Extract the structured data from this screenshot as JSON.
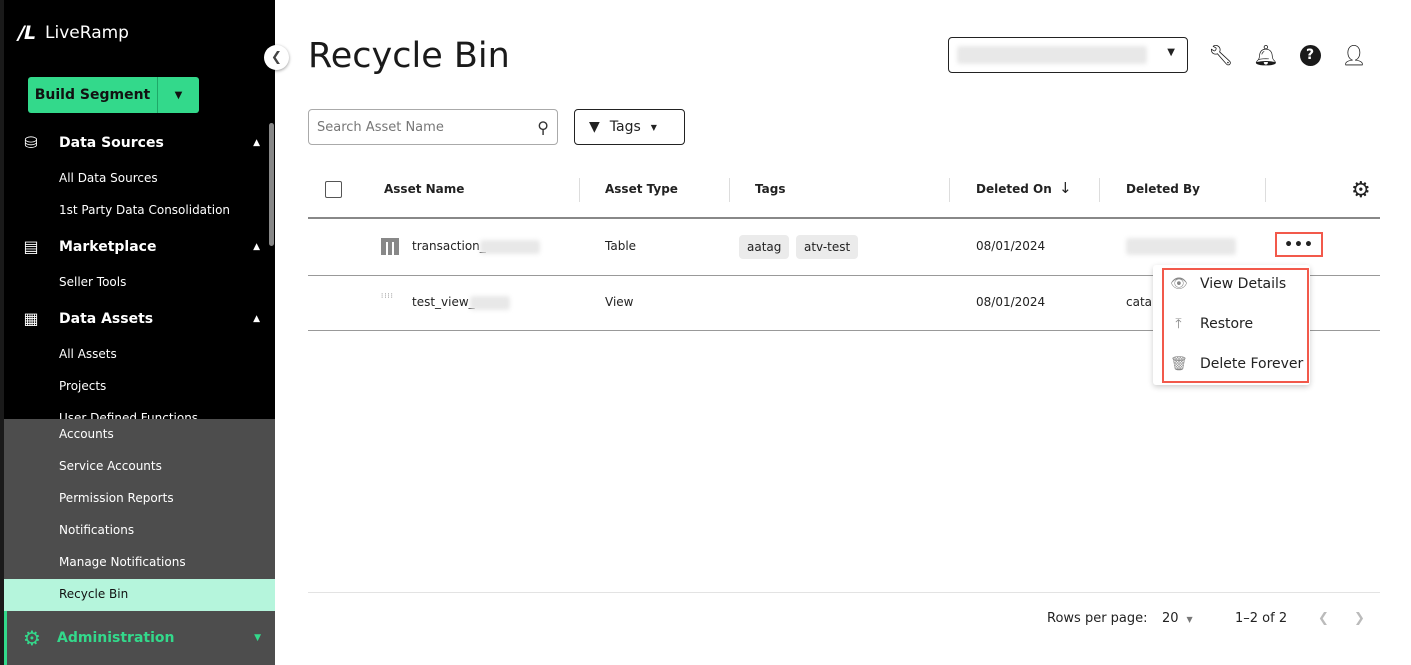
{
  "brand": {
    "name": "LiveRamp",
    "mark": "/L"
  },
  "sidebar": {
    "build_label": "Build Segment",
    "sections": [
      {
        "label": "Data Sources",
        "icon": "data-sources-icon",
        "items": [
          "All Data Sources",
          "1st Party Data Consolidation"
        ]
      },
      {
        "label": "Marketplace",
        "icon": "marketplace-icon",
        "items": [
          "Seller Tools"
        ]
      },
      {
        "label": "Data Assets",
        "icon": "data-assets-icon",
        "items": [
          "All Assets",
          "Projects",
          "User Defined Functions"
        ]
      }
    ],
    "admin_items": [
      "Accounts",
      "Service Accounts",
      "Permission Reports",
      "Notifications",
      "Manage Notifications",
      "Recycle Bin"
    ],
    "admin_label": "Administration",
    "active": "Recycle Bin"
  },
  "header": {
    "title": "Recycle Bin",
    "icons": [
      "wrench-icon",
      "bell-icon",
      "help-icon",
      "user-icon"
    ]
  },
  "toolbar": {
    "search_placeholder": "Search Asset Name",
    "tags_label": "Tags"
  },
  "table": {
    "columns": [
      "Asset Name",
      "Asset Type",
      "Tags",
      "Deleted On",
      "Deleted By"
    ],
    "sort": {
      "column": "Deleted On",
      "direction": "desc"
    },
    "rows": [
      {
        "name": "transaction_",
        "type": "Table",
        "tags": [
          "aatag",
          "atv-test"
        ],
        "deleted_on": "08/01/2024",
        "deleted_by": ""
      },
      {
        "name": "test_view_",
        "type": "View",
        "tags": [],
        "deleted_on": "08/01/2024",
        "deleted_by": "catal"
      }
    ]
  },
  "menu": {
    "items": [
      "View Details",
      "Restore",
      "Delete Forever"
    ]
  },
  "footer": {
    "rows_label": "Rows per page:",
    "rows_value": "20",
    "range": "1–2 of 2"
  },
  "colors": {
    "accent": "#33d98b",
    "highlight": "#b5f5dc",
    "annotation": "#f2594b"
  }
}
